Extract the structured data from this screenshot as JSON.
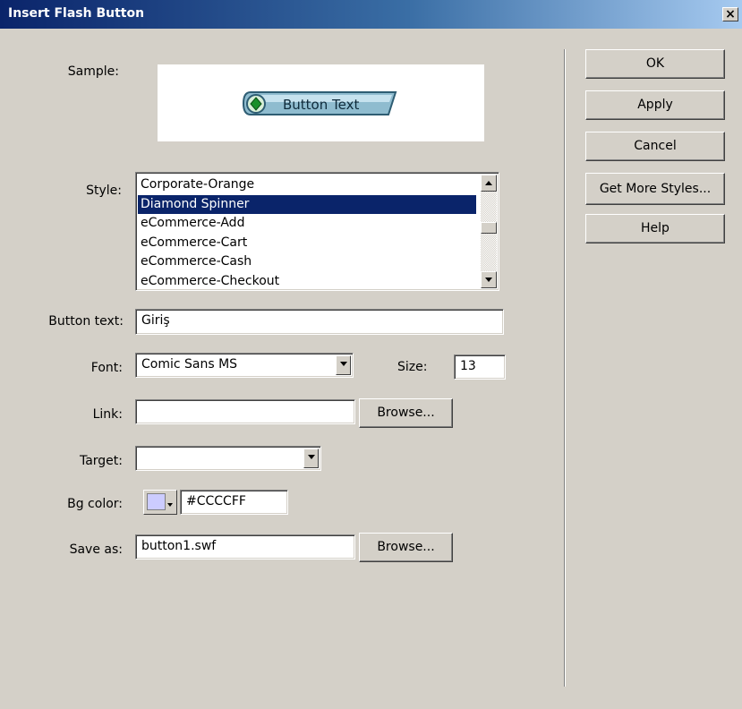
{
  "window": {
    "title": "Insert Flash Button",
    "close_glyph": "×"
  },
  "sample": {
    "label": "Sample:",
    "button_text": "Button Text"
  },
  "style": {
    "label": "Style:",
    "items": [
      {
        "label": "Corporate-Orange",
        "selected": false
      },
      {
        "label": "Diamond Spinner",
        "selected": true
      },
      {
        "label": "eCommerce-Add",
        "selected": false
      },
      {
        "label": "eCommerce-Cart",
        "selected": false
      },
      {
        "label": "eCommerce-Cash",
        "selected": false
      },
      {
        "label": "eCommerce-Checkout",
        "selected": false
      }
    ]
  },
  "button_text": {
    "label": "Button text:",
    "value": "Giriş"
  },
  "font": {
    "label": "Font:",
    "value": "Comic Sans MS"
  },
  "size": {
    "label": "Size:",
    "value": "13"
  },
  "link": {
    "label": "Link:",
    "value": "",
    "browse_label": "Browse..."
  },
  "target": {
    "label": "Target:",
    "value": ""
  },
  "bg_color": {
    "label": "Bg color:",
    "value": "#CCCCFF",
    "swatch": "#ccccff"
  },
  "save_as": {
    "label": "Save as:",
    "value": "button1.swf",
    "browse_label": "Browse..."
  },
  "actions": {
    "ok": "OK",
    "apply": "Apply",
    "cancel": "Cancel",
    "get_more_styles": "Get More Styles...",
    "help": "Help"
  },
  "colors": {
    "title_start": "#0a246a",
    "title_end": "#a6caf0",
    "dialog_bg": "#d4d0c8",
    "selection": "#0a246a"
  }
}
